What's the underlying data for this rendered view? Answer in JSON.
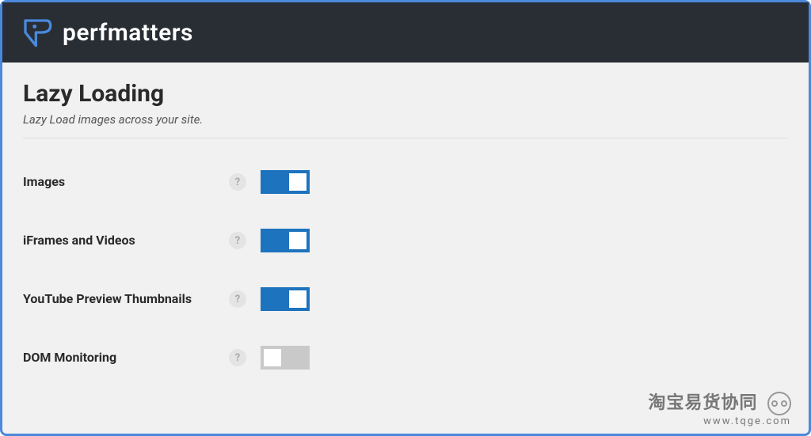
{
  "brand": "perfmatters",
  "section": {
    "title": "Lazy Loading",
    "description": "Lazy Load images across your site."
  },
  "helpGlyph": "?",
  "rows": [
    {
      "label": "Images",
      "on": true
    },
    {
      "label": "iFrames and Videos",
      "on": true
    },
    {
      "label": "YouTube Preview Thumbnails",
      "on": true
    },
    {
      "label": "DOM Monitoring",
      "on": false
    }
  ],
  "watermark": {
    "line1": "淘宝易货协同",
    "line2": "www.tqge.com"
  }
}
